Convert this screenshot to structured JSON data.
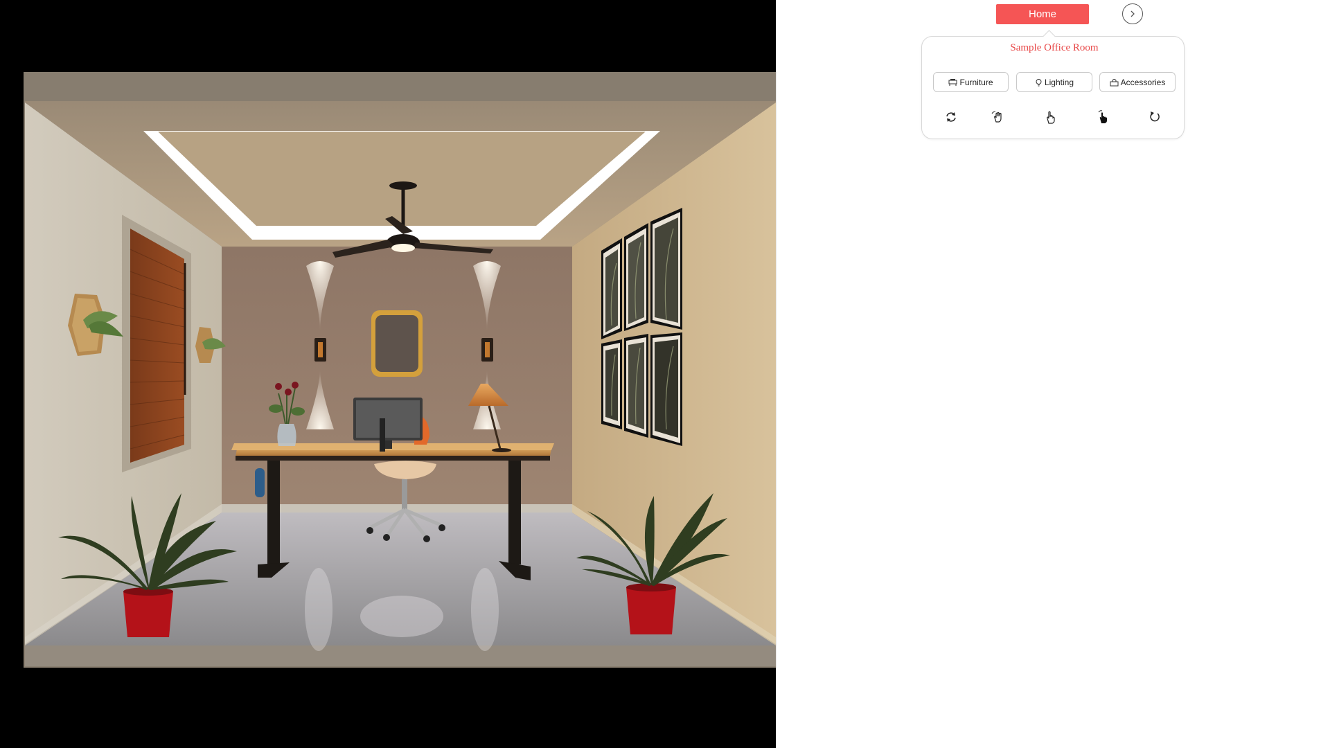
{
  "colors": {
    "accent": "#f55555",
    "title_text": "#e84848"
  },
  "header": {
    "home_label": "Home",
    "next_icon": "chevron-right-icon"
  },
  "room": {
    "title": "Sample Office Room"
  },
  "categories": [
    {
      "label": "Furniture",
      "icon": "furniture-icon"
    },
    {
      "label": "Lighting",
      "icon": "lighting-icon"
    },
    {
      "label": "Accessories",
      "icon": "accessories-icon"
    }
  ],
  "tools": [
    {
      "icon": "reset-rotate-icon"
    },
    {
      "icon": "swipe-hand-icon"
    },
    {
      "icon": "pan-hand-icon"
    },
    {
      "icon": "tap-select-icon"
    },
    {
      "icon": "rotate-icon"
    }
  ]
}
